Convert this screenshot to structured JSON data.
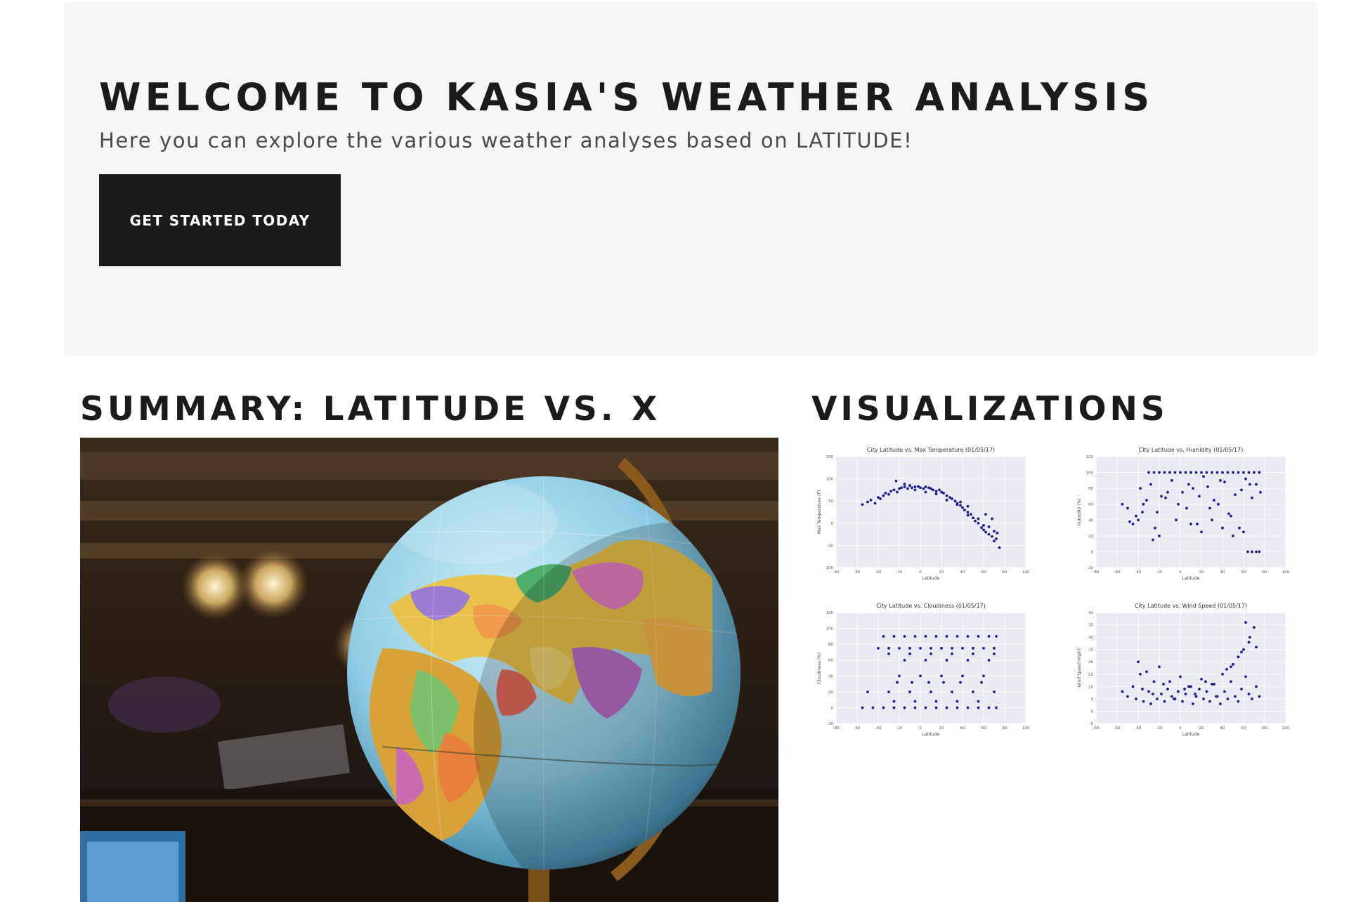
{
  "hero": {
    "title": "WELCOME TO KASIA'S WEATHER ANALYSIS",
    "subtitle": "Here you can explore the various weather analyses based on LATITUDE!",
    "cta_label": "GET STARTED TODAY"
  },
  "summary": {
    "title": "SUMMARY: LATITUDE VS. X"
  },
  "visualizations": {
    "title": "VISUALIZATIONS"
  },
  "chart_data": [
    {
      "type": "scatter",
      "title": "City Latitude vs. Max Temperature (01/05/17)",
      "xlabel": "Latitude",
      "ylabel": "Max Temperature (F)",
      "xlim": [
        -80,
        100
      ],
      "ylim": [
        -100,
        150
      ],
      "xticks": [
        -80,
        -60,
        -40,
        -20,
        0,
        20,
        40,
        60,
        80,
        100
      ],
      "yticks": [
        -100,
        -50,
        0,
        50,
        100,
        150
      ],
      "grid": true,
      "color": "#1c1c8c",
      "x": [
        -55,
        -50,
        -47,
        -43,
        -40,
        -38,
        -35,
        -33,
        -30,
        -28,
        -25,
        -22,
        -20,
        -18,
        -15,
        -12,
        -10,
        -8,
        -5,
        -2,
        0,
        3,
        5,
        8,
        10,
        12,
        15,
        18,
        20,
        22,
        25,
        28,
        30,
        33,
        35,
        38,
        40,
        42,
        45,
        48,
        50,
        52,
        55,
        58,
        60,
        62,
        65,
        68,
        70,
        72,
        75,
        -23,
        -15,
        -5,
        5,
        15,
        25,
        35,
        45,
        55,
        60,
        65,
        70,
        62,
        68,
        73,
        45,
        38
      ],
      "y": [
        42,
        48,
        52,
        45,
        58,
        55,
        62,
        68,
        65,
        72,
        75,
        70,
        78,
        80,
        82,
        78,
        85,
        80,
        82,
        83,
        80,
        78,
        82,
        80,
        78,
        75,
        72,
        75,
        70,
        68,
        62,
        58,
        55,
        50,
        45,
        40,
        35,
        30,
        25,
        20,
        12,
        5,
        0,
        -10,
        -15,
        -20,
        -25,
        -30,
        -40,
        -35,
        -55,
        95,
        88,
        75,
        70,
        66,
        52,
        42,
        18,
        10,
        -5,
        -8,
        -18,
        20,
        10,
        -22,
        38,
        48
      ]
    },
    {
      "type": "scatter",
      "title": "City Latitude vs. Humidity (01/05/17)",
      "xlabel": "Latitude",
      "ylabel": "Humidity (%)",
      "xlim": [
        -80,
        100
      ],
      "ylim": [
        -20,
        120
      ],
      "xticks": [
        -80,
        -60,
        -40,
        -20,
        0,
        20,
        40,
        60,
        80,
        100
      ],
      "yticks": [
        -20,
        0,
        20,
        40,
        60,
        80,
        100,
        120
      ],
      "grid": true,
      "color": "#1c1c8c",
      "x": [
        -30,
        -25,
        -20,
        -15,
        -10,
        -5,
        0,
        5,
        10,
        15,
        20,
        25,
        30,
        35,
        40,
        45,
        50,
        55,
        60,
        65,
        70,
        75,
        -45,
        -40,
        -35,
        -28,
        -18,
        -8,
        2,
        12,
        22,
        32,
        42,
        52,
        62,
        72,
        -50,
        -42,
        -38,
        -32,
        -22,
        -12,
        -2,
        8,
        18,
        28,
        38,
        48,
        58,
        68,
        -55,
        -48,
        -36,
        -24,
        -14,
        -4,
        6,
        16,
        26,
        36,
        46,
        56,
        66,
        76,
        -26,
        -20,
        64,
        68,
        72,
        75,
        60,
        50,
        40,
        30,
        20,
        10
      ],
      "y": [
        100,
        100,
        100,
        100,
        100,
        100,
        100,
        100,
        100,
        100,
        100,
        100,
        100,
        100,
        100,
        100,
        100,
        100,
        100,
        100,
        100,
        100,
        35,
        40,
        60,
        85,
        70,
        90,
        75,
        80,
        95,
        65,
        88,
        72,
        92,
        85,
        55,
        45,
        80,
        65,
        50,
        75,
        60,
        85,
        70,
        55,
        90,
        45,
        78,
        68,
        60,
        38,
        50,
        30,
        68,
        40,
        55,
        35,
        82,
        60,
        48,
        30,
        85,
        75,
        15,
        20,
        0,
        0,
        0,
        0,
        25,
        20,
        30,
        40,
        25,
        35
      ]
    },
    {
      "type": "scatter",
      "title": "City Latitude vs. Cloudiness (01/05/17)",
      "xlabel": "Latitude",
      "ylabel": "Cloudiness (%)",
      "xlim": [
        -80,
        100
      ],
      "ylim": [
        -20,
        120
      ],
      "xticks": [
        -80,
        -60,
        -40,
        -20,
        0,
        20,
        40,
        60,
        80,
        100
      ],
      "yticks": [
        -20,
        0,
        20,
        40,
        60,
        80,
        100,
        120
      ],
      "grid": true,
      "color": "#1c1c8c",
      "x": [
        -55,
        -45,
        -35,
        -25,
        -15,
        -5,
        5,
        15,
        25,
        35,
        45,
        55,
        65,
        72,
        -40,
        -30,
        -20,
        -10,
        0,
        10,
        20,
        30,
        40,
        50,
        60,
        70,
        -35,
        -25,
        -15,
        -5,
        5,
        15,
        25,
        35,
        45,
        55,
        65,
        72,
        -50,
        -30,
        -10,
        10,
        30,
        50,
        70,
        -20,
        0,
        20,
        40,
        60,
        -15,
        5,
        25,
        45,
        65,
        -25,
        -5,
        15,
        35,
        55,
        -30,
        -10,
        10,
        30,
        50,
        70,
        -22,
        -8,
        8,
        22,
        38,
        58
      ],
      "y": [
        0,
        0,
        0,
        0,
        0,
        0,
        0,
        0,
        0,
        0,
        0,
        0,
        0,
        0,
        75,
        75,
        75,
        75,
        75,
        75,
        75,
        75,
        75,
        75,
        75,
        75,
        90,
        90,
        90,
        90,
        90,
        90,
        90,
        90,
        90,
        90,
        90,
        90,
        20,
        20,
        20,
        20,
        20,
        20,
        20,
        40,
        40,
        40,
        40,
        40,
        60,
        60,
        60,
        60,
        60,
        8,
        8,
        8,
        8,
        8,
        68,
        68,
        68,
        68,
        68,
        68,
        32,
        32,
        32,
        32,
        32,
        32
      ]
    },
    {
      "type": "scatter",
      "title": "City Latitude vs. Wind Speed (01/05/17)",
      "xlabel": "Latitude",
      "ylabel": "Wind Speed (mph)",
      "xlim": [
        -80,
        100
      ],
      "ylim": [
        -5,
        40
      ],
      "xticks": [
        -80,
        -60,
        -40,
        -20,
        0,
        20,
        40,
        60,
        80,
        100
      ],
      "yticks": [
        -5,
        0,
        5,
        10,
        15,
        20,
        25,
        30,
        35,
        40
      ],
      "grid": true,
      "color": "#1c1c8c",
      "x": [
        -55,
        -50,
        -45,
        -42,
        -38,
        -35,
        -30,
        -28,
        -25,
        -22,
        -18,
        -15,
        -12,
        -8,
        -5,
        -2,
        2,
        5,
        8,
        12,
        15,
        18,
        22,
        25,
        28,
        32,
        35,
        38,
        42,
        45,
        48,
        52,
        55,
        58,
        62,
        65,
        68,
        72,
        75,
        -40,
        -32,
        -20,
        -10,
        0,
        10,
        20,
        30,
        40,
        50,
        55,
        60,
        65,
        70,
        62,
        66,
        72,
        58,
        48,
        -36,
        -26,
        -16,
        -6,
        4,
        14,
        24,
        34,
        44
      ],
      "y": [
        8,
        6,
        10,
        5,
        15,
        4,
        8,
        3,
        12,
        5,
        7,
        4,
        9,
        6,
        5,
        8,
        4,
        7,
        10,
        3,
        6,
        9,
        5,
        8,
        4,
        11,
        6,
        3,
        8,
        5,
        12,
        6,
        4,
        9,
        14,
        7,
        5,
        10,
        6,
        20,
        16,
        18,
        12,
        14,
        10,
        13,
        11,
        15,
        19,
        22,
        25,
        28,
        34,
        36,
        30,
        26,
        24,
        18,
        9,
        7,
        11,
        5,
        9,
        7,
        12,
        6,
        17
      ]
    }
  ]
}
